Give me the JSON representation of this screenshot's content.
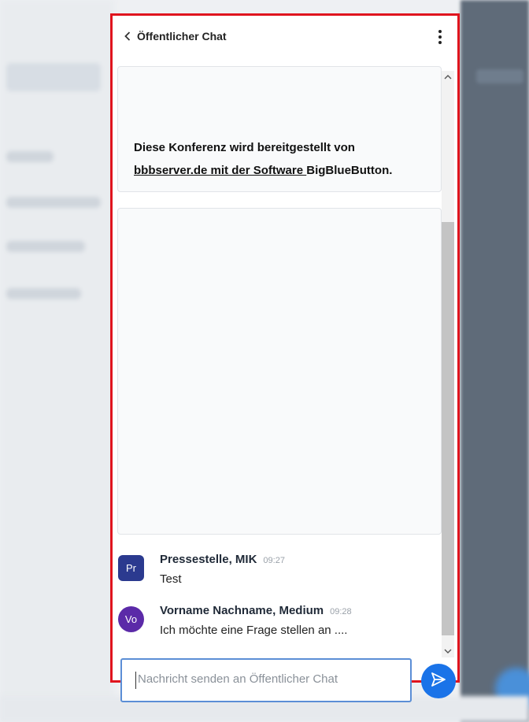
{
  "header": {
    "title": "Öffentlicher Chat",
    "back_icon": "chevron-left-icon",
    "menu_icon": "kebab-menu-icon"
  },
  "welcome": {
    "line1": "Diese Konferenz wird bereitgestellt von",
    "link_text": "bbbserver.de mit der Software ",
    "after_link": "BigBlueButton."
  },
  "messages": [
    {
      "avatar": "Pr",
      "name": "Pressestelle, MIK",
      "time": "09:27",
      "text": "Test",
      "color": "#2b3a8f"
    },
    {
      "avatar": "Vo",
      "name": "Vorname Nachname, Medium",
      "time": "09:28",
      "text": "Ich möchte eine Frage stellen an ....",
      "color": "#5b2aa8"
    }
  ],
  "composer": {
    "placeholder": "Nachricht senden an Öffentlicher Chat",
    "send_icon": "send-icon"
  },
  "colors": {
    "highlight_border": "#e0141e",
    "accent": "#1a73e8"
  }
}
